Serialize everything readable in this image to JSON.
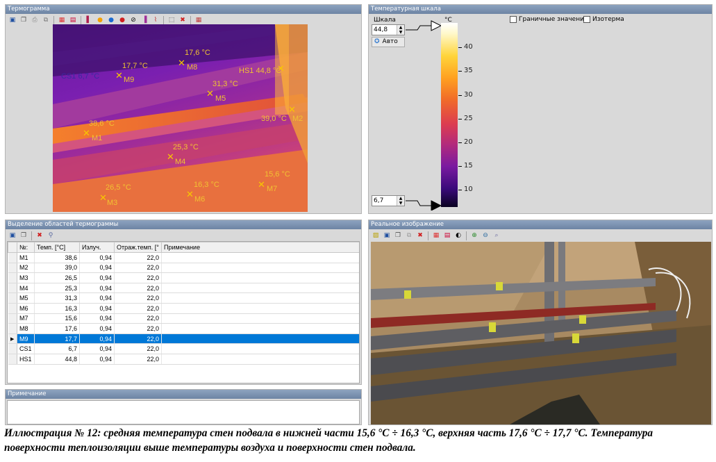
{
  "thermogram_panel": {
    "title": "Термограмма"
  },
  "thermo_labels": [
    {
      "id": "M1",
      "temp": "38,6 °C",
      "name": "M1"
    },
    {
      "id": "M2",
      "temp": "39,0 °C",
      "name": "M2"
    },
    {
      "id": "M3",
      "temp": "26,5 °C",
      "name": "M3"
    },
    {
      "id": "M4",
      "temp": "25,3 °C",
      "name": "M4"
    },
    {
      "id": "M5",
      "temp": "31,3 °C",
      "name": "M5"
    },
    {
      "id": "M6",
      "temp": "16,3 °C",
      "name": "M6"
    },
    {
      "id": "M7",
      "temp": "15,6 °C",
      "name": "M7"
    },
    {
      "id": "M8",
      "temp": "17,6 °C",
      "name": "M8"
    },
    {
      "id": "M9",
      "temp": "17,7 °C",
      "name": "M9"
    },
    {
      "id": "HS1",
      "temp": "HS1 44,8 °C",
      "name": ""
    },
    {
      "id": "CS1",
      "temp": "CS1 6,7 °C",
      "name": ""
    }
  ],
  "scale_panel": {
    "title": "Температурная шкала",
    "scale_label": "Шкала",
    "max_value": "44,8",
    "min_value": "6,7",
    "auto_button": "Авто",
    "unit": "°C",
    "ticks": [
      "40",
      "35",
      "30",
      "25",
      "20",
      "15",
      "10"
    ],
    "boundary_label": "Граничные значения",
    "isotherm_label": "Изотерма"
  },
  "regions_panel": {
    "title": "Выделение областей термограммы",
    "columns": [
      "№:",
      "Темп. [°C]",
      "Излуч.",
      "Отраж.темп. [°",
      "Примечание"
    ],
    "rows": [
      {
        "n": "M1",
        "t": "38,6",
        "e": "0,94",
        "r": "22,0",
        "note": "",
        "selected": false
      },
      {
        "n": "M2",
        "t": "39,0",
        "e": "0,94",
        "r": "22,0",
        "note": "",
        "selected": false
      },
      {
        "n": "M3",
        "t": "26,5",
        "e": "0,94",
        "r": "22,0",
        "note": "",
        "selected": false
      },
      {
        "n": "M4",
        "t": "25,3",
        "e": "0,94",
        "r": "22,0",
        "note": "",
        "selected": false
      },
      {
        "n": "M5",
        "t": "31,3",
        "e": "0,94",
        "r": "22,0",
        "note": "",
        "selected": false
      },
      {
        "n": "M6",
        "t": "16,3",
        "e": "0,94",
        "r": "22,0",
        "note": "",
        "selected": false
      },
      {
        "n": "M7",
        "t": "15,6",
        "e": "0,94",
        "r": "22,0",
        "note": "",
        "selected": false
      },
      {
        "n": "M8",
        "t": "17,6",
        "e": "0,94",
        "r": "22,0",
        "note": "",
        "selected": false
      },
      {
        "n": "M9",
        "t": "17,7",
        "e": "0,94",
        "r": "22,0",
        "note": "",
        "selected": true
      },
      {
        "n": "CS1",
        "t": "6,7",
        "e": "0,94",
        "r": "22,0",
        "note": "",
        "selected": false
      },
      {
        "n": "HS1",
        "t": "44,8",
        "e": "0,94",
        "r": "22,0",
        "note": "",
        "selected": false
      }
    ]
  },
  "note_panel": {
    "title": "Примечание"
  },
  "photo_panel": {
    "title": "Реальное изображение"
  },
  "caption": "Иллюстрация № 12: средняя температура стен подвала в нижней части 15,6 °C ÷ 16,3 °C, верхняя часть 17,6 °C ÷ 17,7 °C. Температура поверхности теплоизоляции выше температуры воздуха и поверхности стен подвала.",
  "colors": {
    "title_bar": "#7890b0",
    "selection": "#0078d7",
    "marker": "#f1c232"
  }
}
